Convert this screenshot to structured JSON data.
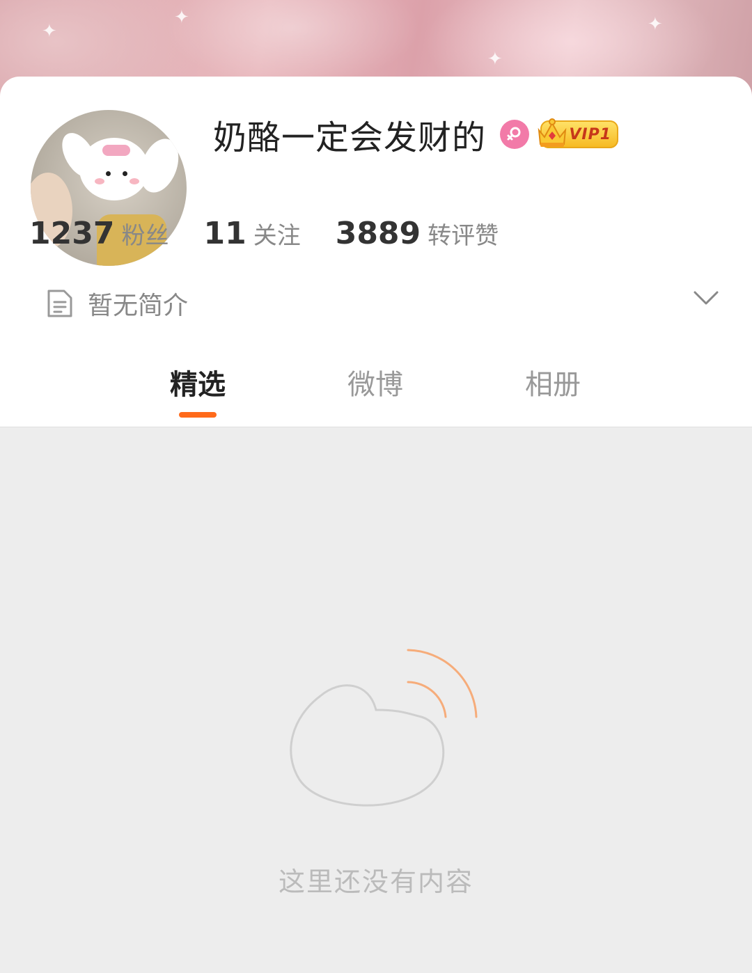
{
  "profile": {
    "name": "奶酪一定会发财的",
    "vip_label": "VIP1",
    "gender_icon": "female-icon"
  },
  "stats": [
    {
      "value": "1237",
      "label": "粉丝"
    },
    {
      "value": "11",
      "label": "关注"
    },
    {
      "value": "3889",
      "label": "转评赞"
    }
  ],
  "intro": {
    "text": "暂无简介"
  },
  "tabs": [
    {
      "label": "精选",
      "active": true
    },
    {
      "label": "微博",
      "active": false
    },
    {
      "label": "相册",
      "active": false
    }
  ],
  "empty_state": {
    "text": "这里还没有内容"
  },
  "colors": {
    "accent": "#ff6a1a",
    "gender_pink": "#f27aa8",
    "vip_gold": "#f6b820"
  }
}
